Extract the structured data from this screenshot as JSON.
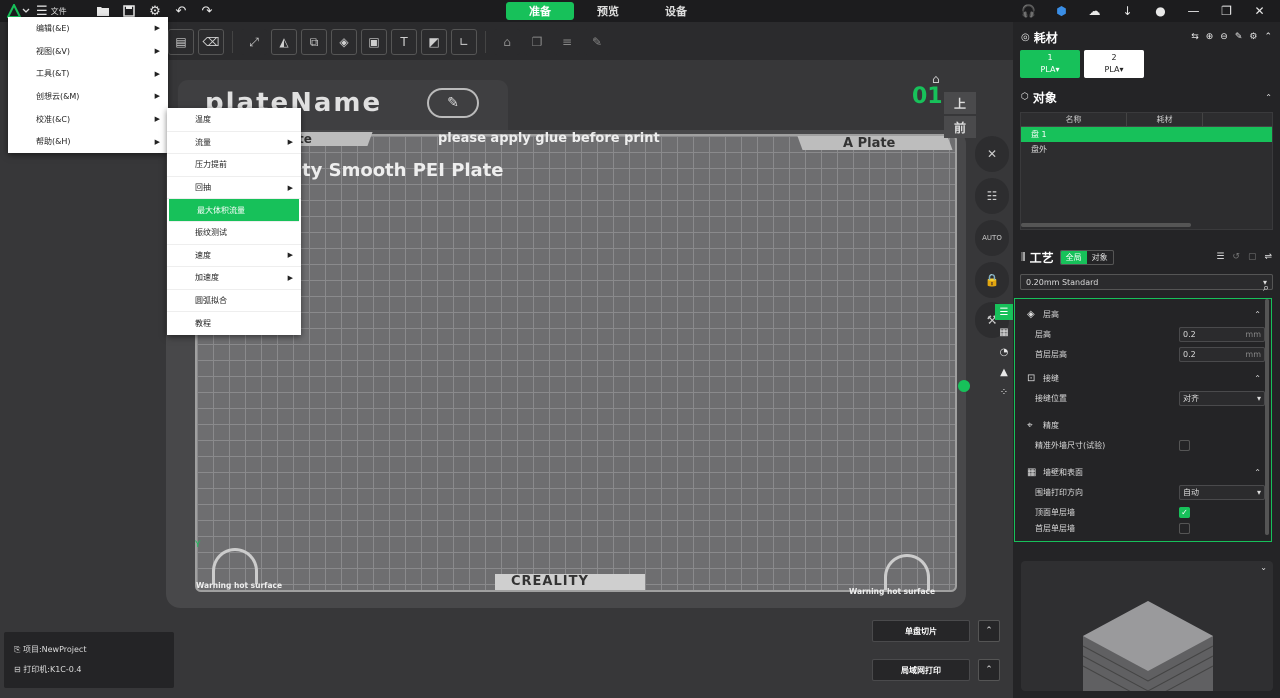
{
  "titlebar": {
    "file_label": "文件",
    "tabs": [
      {
        "label": "准备",
        "active": true
      },
      {
        "label": "预览",
        "active": false
      },
      {
        "label": "设备",
        "active": false
      }
    ]
  },
  "viewport": {
    "plate_name": "plateName",
    "bed_top_text": "please apply glue before print",
    "bed_left_tab_text": "te",
    "bed_right_tab_text": "A Plate",
    "bed_plate_text": "ty Smooth PEI Plate",
    "bed_bottom_brand": "CREALITY",
    "warning_left": "Warning hot surface",
    "warning_right": "Warning hot surface",
    "plate_index": "01",
    "view_up": "上",
    "view_front": "前",
    "auto_label": "AUTO"
  },
  "menu": {
    "items": [
      {
        "label": "编辑(&E)"
      },
      {
        "label": "视图(&V)"
      },
      {
        "label": "工具(&T)"
      },
      {
        "label": "创想云(&M)"
      },
      {
        "label": "校准(&C)"
      },
      {
        "label": "帮助(&H)"
      }
    ]
  },
  "submenu": {
    "items": [
      {
        "label": "温度"
      },
      {
        "label": "流量"
      },
      {
        "label": "压力提前"
      },
      {
        "label": "回抽"
      },
      {
        "label": "最大体积流量"
      },
      {
        "label": "振纹测试"
      },
      {
        "label": "速度"
      },
      {
        "label": "加速度"
      },
      {
        "label": "圆弧拟合"
      },
      {
        "label": "教程"
      }
    ]
  },
  "filament": {
    "title": "耗材",
    "slots": [
      {
        "num": "1",
        "type": "PLA"
      },
      {
        "num": "2",
        "type": "PLA"
      }
    ]
  },
  "objects": {
    "title": "对象",
    "col_name": "名称",
    "col_filament": "耗材",
    "rows": [
      "盘 1",
      "盘外"
    ]
  },
  "process": {
    "title": "工艺",
    "seg_global": "全局",
    "seg_object": "对象",
    "preset": "0.20mm Standard",
    "groups": {
      "layer": "层高",
      "seam": "接缝",
      "precision": "精度",
      "walls": "墙壁和表面"
    },
    "rows": {
      "layer_height": {
        "label": "层高",
        "value": "0.2",
        "unit": "mm"
      },
      "first_layer": {
        "label": "首层层高",
        "value": "0.2",
        "unit": "mm"
      },
      "seam_pos": {
        "label": "接缝位置",
        "value": "对齐"
      },
      "precise_wall": {
        "label": "精准外墙尺寸(试验)"
      },
      "wall_dir": {
        "label": "围墙打印方向",
        "value": "自动"
      },
      "top_single": {
        "label": "顶面单层墙"
      },
      "bottom_single": {
        "label": "首层单层墙"
      }
    }
  },
  "status": {
    "project": "项目:NewProject",
    "printer": "打印机:K1C-0.4"
  },
  "actions": {
    "slice": "单盘切片",
    "lan_print": "局域网打印"
  },
  "colors": {
    "accent": "#17c15a"
  }
}
